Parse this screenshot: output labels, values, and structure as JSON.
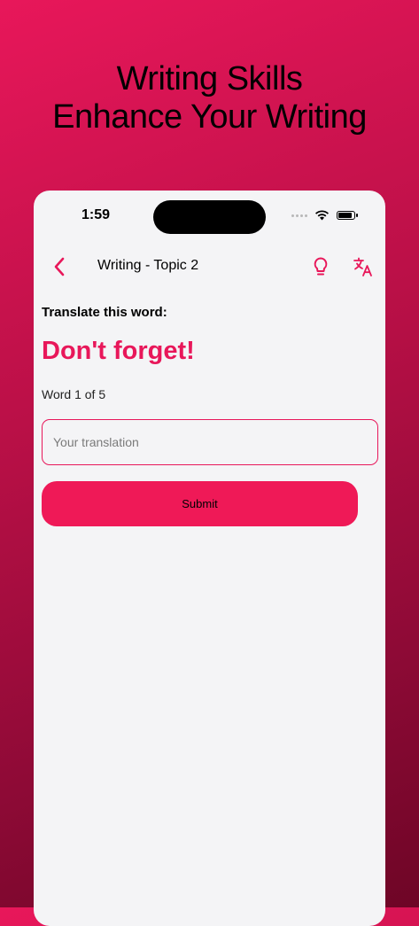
{
  "promo": {
    "line1": "Writing Skills",
    "line2": "Enhance Your Writing"
  },
  "status_bar": {
    "time": "1:59"
  },
  "nav": {
    "title": "Writing - Topic 2",
    "icons": {
      "back": "chevron-left-icon",
      "hint": "lightbulb-icon",
      "translate": "translate-icon"
    }
  },
  "exercise": {
    "prompt": "Translate this word:",
    "word": "Don't forget!",
    "progress": "Word 1 of 5",
    "input_placeholder": "Your translation",
    "input_value": "",
    "submit_label": "Submit"
  },
  "colors": {
    "accent": "#e8175a",
    "button": "#ef1957",
    "background_gradient_start": "#e8175a",
    "background_gradient_end": "#6e0526",
    "card": "#f4f4f6"
  }
}
